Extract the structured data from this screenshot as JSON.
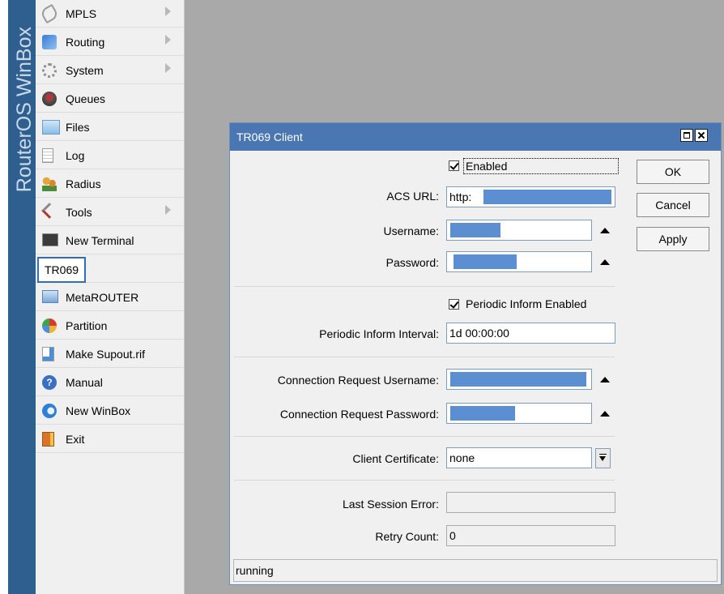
{
  "brand": "RouterOS WinBox",
  "menu": {
    "items": [
      {
        "label": "MPLS",
        "icon": "mpls-icon",
        "arrow": true
      },
      {
        "label": "Routing",
        "icon": "routing-icon",
        "arrow": true
      },
      {
        "label": "System",
        "icon": "system-gear-icon",
        "arrow": true
      },
      {
        "label": "Queues",
        "icon": "queues-icon",
        "arrow": false
      },
      {
        "label": "Files",
        "icon": "folder-icon",
        "arrow": false
      },
      {
        "label": "Log",
        "icon": "log-document-icon",
        "arrow": false
      },
      {
        "label": "Radius",
        "icon": "radius-users-icon",
        "arrow": false
      },
      {
        "label": "Tools",
        "icon": "tools-icon",
        "arrow": true
      },
      {
        "label": "New Terminal",
        "icon": "terminal-icon",
        "arrow": false
      },
      {
        "label": "TR069",
        "icon": "",
        "arrow": false
      },
      {
        "label": "MetaROUTER",
        "icon": "metarouter-icon",
        "arrow": false
      },
      {
        "label": "Partition",
        "icon": "partition-pie-icon",
        "arrow": false
      },
      {
        "label": "Make Supout.rif",
        "icon": "supout-icon",
        "arrow": false
      },
      {
        "label": "Manual",
        "icon": "help-icon",
        "arrow": false
      },
      {
        "label": "New WinBox",
        "icon": "winbox-icon",
        "arrow": false
      },
      {
        "label": "Exit",
        "icon": "exit-door-icon",
        "arrow": false
      }
    ],
    "selected": "TR069"
  },
  "dialog": {
    "title": "TR069 Client",
    "enabled_label": "Enabled",
    "enabled": true,
    "acs_url_label": "ACS URL:",
    "acs_url_value": "http:",
    "username_label": "Username:",
    "password_label": "Password:",
    "periodic_inform_enabled_label": "Periodic Inform Enabled",
    "periodic_inform_enabled": true,
    "periodic_inform_interval_label": "Periodic Inform Interval:",
    "periodic_inform_interval_value": "1d 00:00:00",
    "conn_req_username_label": "Connection Request Username:",
    "conn_req_password_label": "Connection Request Password:",
    "client_certificate_label": "Client Certificate:",
    "client_certificate_value": "none",
    "last_session_error_label": "Last Session Error:",
    "last_session_error_value": "",
    "retry_count_label": "Retry Count:",
    "retry_count_value": "0",
    "buttons": {
      "ok": "OK",
      "cancel": "Cancel",
      "apply": "Apply"
    },
    "status": "running"
  },
  "colors": {
    "title_bar": "#4a77b2",
    "redaction": "#5b8fd1",
    "brand_strip": "#2f5f8f",
    "desktop": "#a9a9a9"
  }
}
